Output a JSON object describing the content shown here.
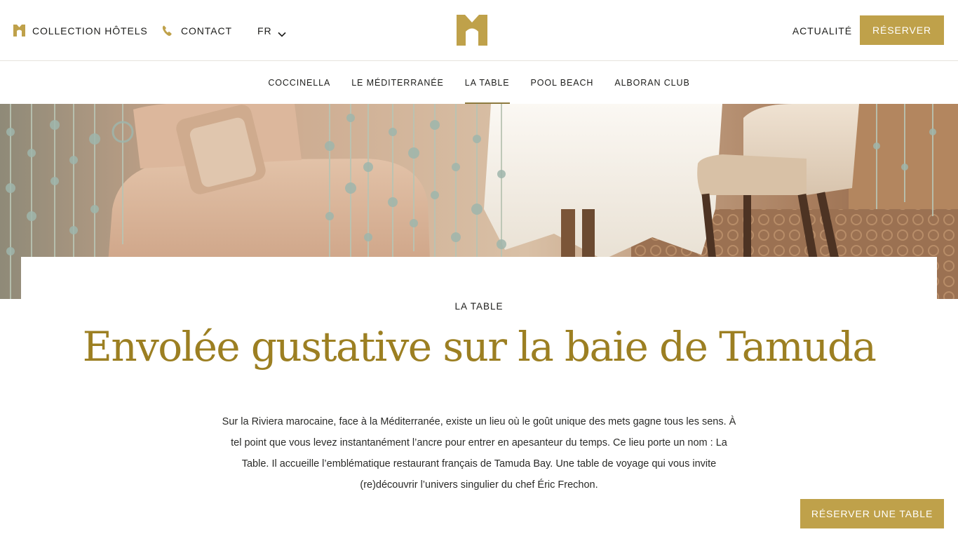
{
  "header": {
    "collection_label": "COLLECTION HÔTELS",
    "contact_label": "CONTACT",
    "language_label": "FR",
    "news_label": "ACTUALITÉ",
    "reserve_label": "RÉSERVER"
  },
  "subnav": {
    "items": [
      {
        "label": "COCCINELLA"
      },
      {
        "label": "LE MÉDITERRANÉE"
      },
      {
        "label": "LA TABLE"
      },
      {
        "label": "POOL BEACH"
      },
      {
        "label": "ALBORAN CLUB"
      }
    ],
    "active": "LA TABLE"
  },
  "content": {
    "eyebrow": "LA TABLE",
    "headline": "Envolée gustative sur la baie de Tamuda",
    "body": "Sur la Riviera marocaine, face à la Méditerranée, existe un lieu où le goût unique des mets gagne tous les sens. À tel point que vous levez instantanément l’ancre pour entrer en apesanteur du temps. Ce lieu porte un nom : La Table. Il accueille l’emblématique restaurant français de Tamuda Bay. Une table de voyage qui vous invite (re)découvrir l’univers singulier du chef Éric Frechon."
  },
  "cta": {
    "reserve_table_label": "RÉSERVER UNE TABLE"
  },
  "icons": {
    "collection": "hotel-logo-icon",
    "contact": "phone-icon",
    "language": "chevron-down-icon"
  },
  "colors": {
    "accent_gold": "#bfa14a",
    "headline_gold": "#9c7f22"
  }
}
